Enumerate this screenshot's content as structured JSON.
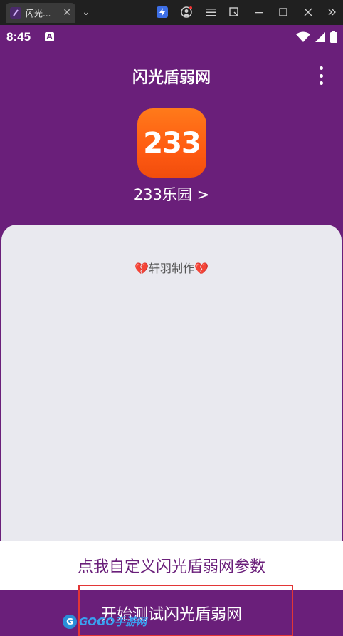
{
  "browser": {
    "tab_title": "闪光...",
    "tab_close": "✕",
    "chevron": "⌄"
  },
  "status": {
    "time": "8:45",
    "a_badge": "A"
  },
  "app": {
    "title": "闪光盾弱网",
    "icon_text": "233",
    "app_name": "233乐园 >"
  },
  "card": {
    "credit": "轩羽制作",
    "heart_glyph": "💔"
  },
  "buttons": {
    "config": "点我自定义闪光盾弱网参数",
    "start": "开始测试闪光盾弱网"
  },
  "watermark": {
    "logo": "G",
    "text": "GOGO手游网"
  },
  "colors": {
    "purple": "#6a1f7a",
    "card_bg": "#e9e9ef",
    "highlight": "#e23636",
    "icon_orange": "#ff5b12"
  }
}
